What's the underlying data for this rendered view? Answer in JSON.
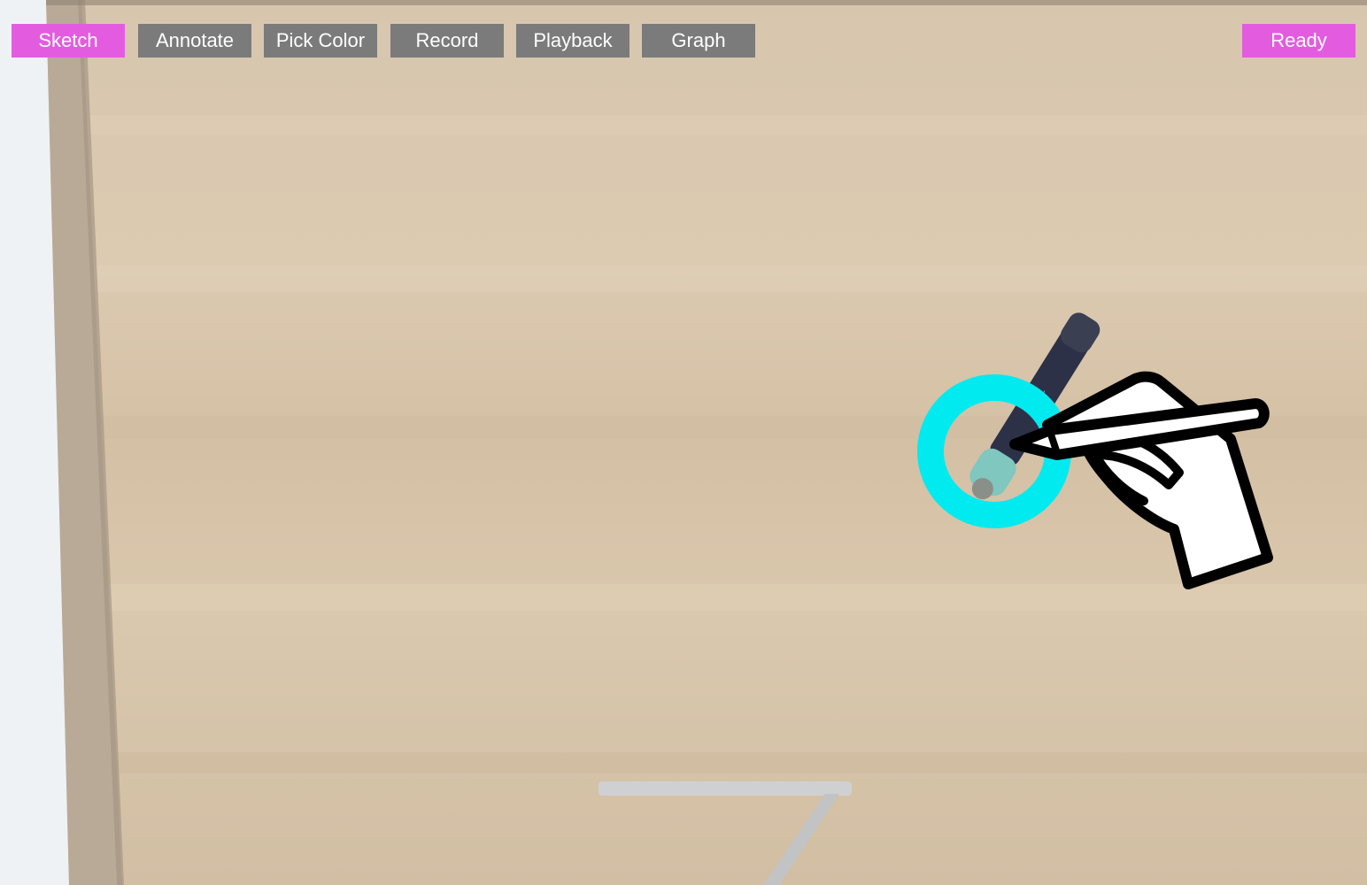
{
  "toolbar": {
    "buttons": [
      {
        "id": "sketch",
        "label": "Sketch",
        "active": true
      },
      {
        "id": "annotate",
        "label": "Annotate",
        "active": false
      },
      {
        "id": "pick-color",
        "label": "Pick Color",
        "active": false
      },
      {
        "id": "record",
        "label": "Record",
        "active": false
      },
      {
        "id": "playback",
        "label": "Playback",
        "active": false
      },
      {
        "id": "graph",
        "label": "Graph",
        "active": false
      }
    ]
  },
  "status": {
    "label": "Ready"
  },
  "colors": {
    "accent": "#e35ce0",
    "button_inactive": "#7b7b7b",
    "cursor_ring": "#00eaf0",
    "wood": "#d9c7ad"
  },
  "icons": {
    "cursor": "hand-holding-pen-icon",
    "target": "target-ring-icon"
  }
}
